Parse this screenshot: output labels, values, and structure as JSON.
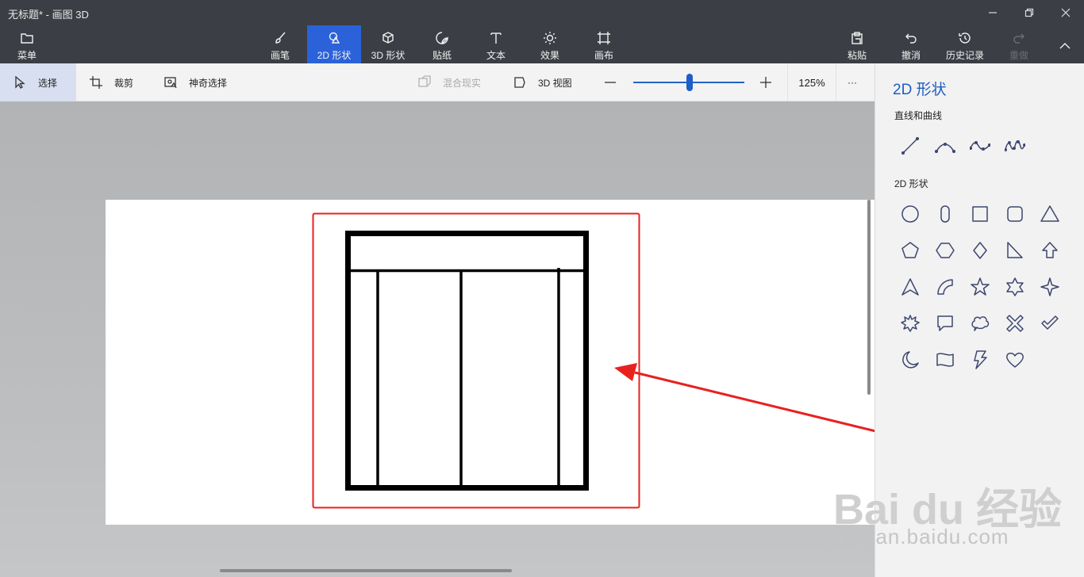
{
  "window": {
    "title": "无标题* - 画图 3D"
  },
  "ribbon": {
    "menu_label": "菜单",
    "tools": [
      {
        "label": "画笔",
        "icon": "brush-icon"
      },
      {
        "label": "2D 形状",
        "icon": "shapes-2d-icon"
      },
      {
        "label": "3D 形状",
        "icon": "cube-icon"
      },
      {
        "label": "贴纸",
        "icon": "sticker-icon"
      },
      {
        "label": "文本",
        "icon": "text-icon"
      },
      {
        "label": "效果",
        "icon": "sun-icon"
      },
      {
        "label": "画布",
        "icon": "canvas-icon"
      }
    ],
    "active_tool": "2D 形状",
    "actions": [
      {
        "label": "粘贴",
        "icon": "paste-icon",
        "enabled": true
      },
      {
        "label": "撤消",
        "icon": "undo-icon",
        "enabled": true
      },
      {
        "label": "历史记录",
        "icon": "history-icon",
        "enabled": true
      },
      {
        "label": "重做",
        "icon": "redo-icon",
        "enabled": false
      }
    ]
  },
  "subbar": {
    "select": "选择",
    "crop": "裁剪",
    "magic_select": "神奇选择",
    "mixed_reality": "混合现实",
    "view_3d": "3D 视图",
    "zoom_percent": "125%",
    "zoom_fraction": 0.5,
    "more": "···"
  },
  "panel": {
    "title": "2D 形状",
    "lines_label": "直线和曲线",
    "shapes_label": "2D 形状",
    "lines": [
      "line-icon",
      "curve-icon",
      "two-point-curve-icon",
      "three-point-curve-icon"
    ],
    "shapes": [
      "circle-icon",
      "rounded-rect-icon",
      "square-icon",
      "rounded-square-icon",
      "triangle-icon",
      "pentagon-icon",
      "hexagon-icon",
      "diamond-icon",
      "right-triangle-icon",
      "arrow-up-icon",
      "arrowhead-icon",
      "quarter-circle-icon",
      "star-5-icon",
      "star-6-icon",
      "star-4-icon",
      "burst-icon",
      "speech-bubble-icon",
      "thought-bubble-icon",
      "x-icon",
      "check-icon",
      "moon-icon",
      "banner-icon",
      "lightning-icon",
      "heart-icon"
    ]
  },
  "colors": {
    "ribbon_bg": "#3b3e44",
    "active_tool": "#2b62d9",
    "accent": "#1f5fbf",
    "annotation": "#e8211f"
  },
  "watermark": {
    "logo": "Bai du 经验",
    "url": "jingyan.baidu.com"
  }
}
